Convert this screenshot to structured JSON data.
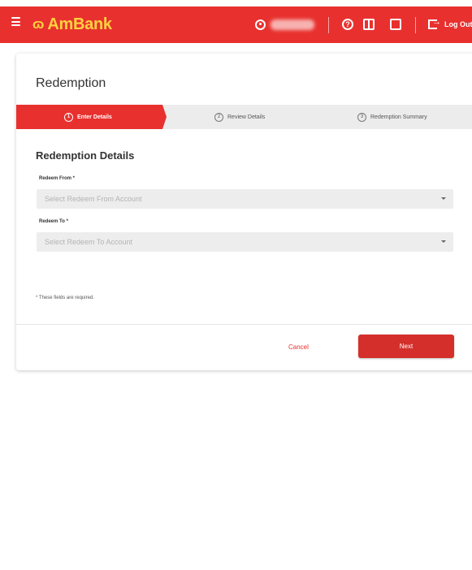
{
  "header": {
    "logo_mark": "ɷ",
    "brand": "AmBank",
    "logout_label": "Log Out",
    "icons": [
      "menu-icon",
      "user-icon",
      "help-icon",
      "book-icon",
      "chat-icon",
      "logout-icon"
    ]
  },
  "page": {
    "title": "Redemption"
  },
  "stepper": {
    "steps": [
      {
        "num": "1",
        "label": "Enter Details",
        "active": true
      },
      {
        "num": "2",
        "label": "Review Details",
        "active": false
      },
      {
        "num": "3",
        "label": "Redemption Summary",
        "active": false
      }
    ]
  },
  "form": {
    "section_title": "Redemption Details",
    "redeem_from": {
      "label": "Redeem From *",
      "placeholder": "Select Redeem From Account"
    },
    "redeem_to": {
      "label": "Redeem To *",
      "placeholder": "Select Redeem To Account"
    },
    "required_note": "* These fields are required."
  },
  "actions": {
    "cancel": "Cancel",
    "next": "Next"
  },
  "colors": {
    "brand_red": "#e8312f",
    "logo_yellow": "#ffd23f",
    "button_red": "#d42f2b"
  }
}
